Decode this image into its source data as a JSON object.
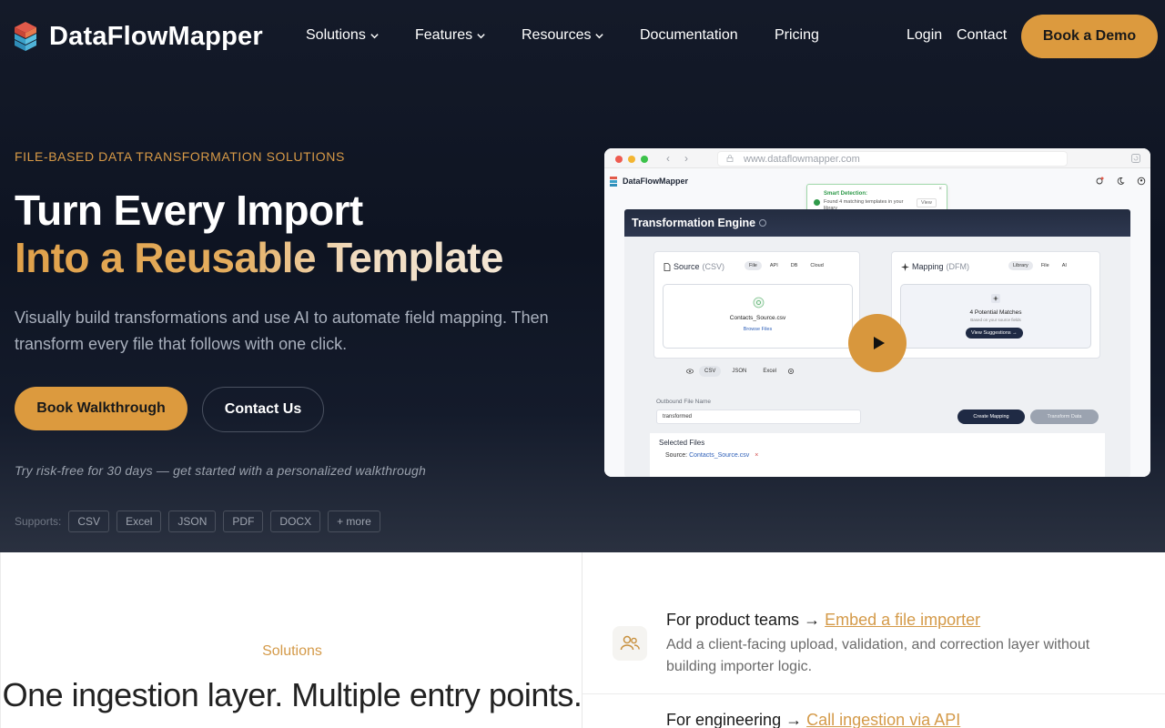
{
  "header": {
    "brand": "DataFlowMapper",
    "nav": [
      {
        "label": "Solutions",
        "dropdown": true
      },
      {
        "label": "Features",
        "dropdown": true
      },
      {
        "label": "Resources",
        "dropdown": true
      },
      {
        "label": "Documentation",
        "dropdown": false
      },
      {
        "label": "Pricing",
        "dropdown": false
      }
    ],
    "login": "Login",
    "contact": "Contact",
    "cta": "Book a Demo"
  },
  "hero": {
    "eyebrow": "FILE-BASED DATA TRANSFORMATION SOLUTIONS",
    "title_line1": "Turn Every Import",
    "title_line2": "Into a Reusable Template",
    "lede": "Visually build transformations and use AI to automate field mapping. Then transform every file that follows with one click.",
    "primary_cta": "Book Walkthrough",
    "secondary_cta": "Contact Us",
    "trial_note": "Try risk-free for 30 days — get started with a personalized walkthrough",
    "supports_label": "Supports:",
    "formats": [
      "CSV",
      "Excel",
      "JSON",
      "PDF",
      "DOCX",
      "+ more"
    ]
  },
  "preview": {
    "url": "www.dataflowmapper.com",
    "app_brand": "DataFlowMapper",
    "toast": {
      "title": "Smart Detection:",
      "message": "Found 4 matching templates in your library",
      "action": "View",
      "close": "×"
    },
    "engine_title": "Transformation Engine",
    "source": {
      "title": "Source",
      "subtitle": "(CSV)",
      "chips": [
        "File",
        "API",
        "DB",
        "Cloud"
      ],
      "file_name": "Contacts_Source.csv",
      "browse": "Browse Files"
    },
    "mapping": {
      "title": "Mapping",
      "subtitle": "(DFM)",
      "chips": [
        "Library",
        "File",
        "AI"
      ],
      "matches": "4 Potential Matches",
      "matches_sub": "Based on your source fields",
      "action": "View Suggestions →"
    },
    "formats": [
      "CSV",
      "JSON",
      "Excel"
    ],
    "outbound_label": "Outbound File Name",
    "outbound_value": "transformed",
    "create_mapping": "Create Mapping",
    "transform_data": "Transform Data",
    "selected_files": "Selected Files",
    "source_label": "Source:",
    "source_file": "Contacts_Source.csv",
    "remove": "×"
  },
  "solutions": {
    "label": "Solutions",
    "title": "One ingestion layer. Multiple entry points.",
    "items": [
      {
        "lead": "For product teams",
        "link": "Embed a file importer",
        "desc": "Add a client-facing upload, validation, and correction layer without building importer logic."
      },
      {
        "lead": "For engineering",
        "link": "Call ingestion via API",
        "desc": ""
      }
    ]
  },
  "colors": {
    "accent": "#dc9a3e",
    "hero_bg": "#0e1422",
    "text_muted": "#a9b0bd"
  }
}
